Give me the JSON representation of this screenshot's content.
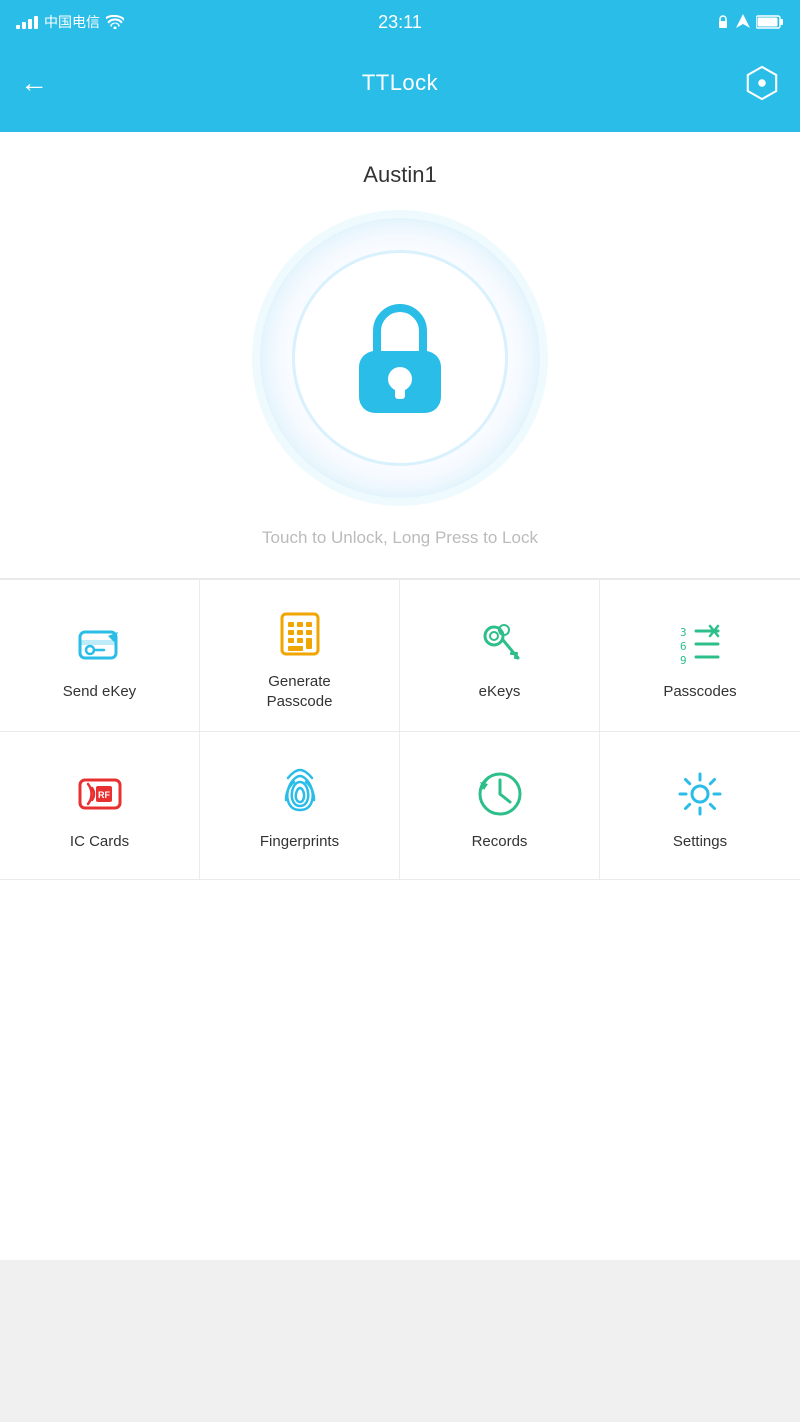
{
  "status_bar": {
    "carrier": "中国电信",
    "time": "23:11"
  },
  "nav": {
    "back_label": "←",
    "title": "TTLock",
    "settings_icon": "hex-settings-icon"
  },
  "lock": {
    "name": "Austin1",
    "hint": "Touch to Unlock, Long Press to Lock"
  },
  "menu": {
    "row1": [
      {
        "id": "send-ekey",
        "label": "Send eKey",
        "icon": "send-ekey-icon",
        "color": "#29bde8"
      },
      {
        "id": "generate-passcode",
        "label": "Generate\nPasscode",
        "icon": "generate-passcode-icon",
        "color": "#f0a500"
      },
      {
        "id": "ekeys",
        "label": "eKeys",
        "icon": "ekeys-icon",
        "color": "#2dbf8a"
      },
      {
        "id": "passcodes",
        "label": "Passcodes",
        "icon": "passcodes-icon",
        "color": "#2dbf8a"
      }
    ],
    "row2": [
      {
        "id": "ic-cards",
        "label": "IC Cards",
        "icon": "ic-cards-icon",
        "color": "#e83030"
      },
      {
        "id": "fingerprints",
        "label": "Fingerprints",
        "icon": "fingerprints-icon",
        "color": "#29bde8"
      },
      {
        "id": "records",
        "label": "Records",
        "icon": "records-icon",
        "color": "#2dbf8a"
      },
      {
        "id": "settings",
        "label": "Settings",
        "icon": "settings-icon",
        "color": "#29bde8"
      }
    ]
  }
}
